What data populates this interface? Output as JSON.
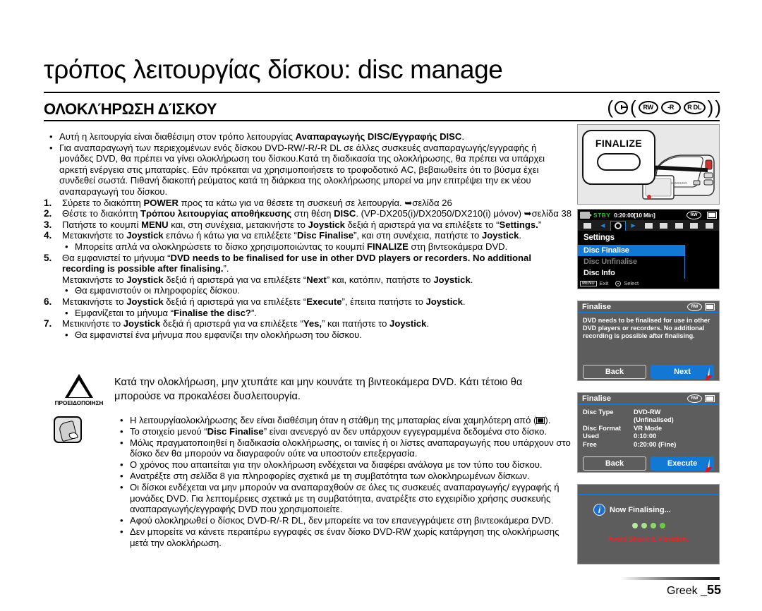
{
  "header": {
    "chapter_title": "τρόπος λειτουργίας δίσκου: disc manage",
    "section_title": "ΟΛΟΚΛΉΡΩΣΗ ΔΊΣΚΟΥ",
    "disc_badges": [
      "RW",
      "-R",
      "R DL"
    ]
  },
  "content": {
    "bullets_top": [
      {
        "parts": [
          {
            "t": "Αυτή η λειτουργία είναι διαθέσιμη στον τρόπο λειτουργίας ",
            "b": false
          },
          {
            "t": "Αναπαραγωγής DISC/Εγγραφής DISC",
            "b": true
          },
          {
            "t": ".",
            "b": false
          }
        ]
      },
      {
        "parts": [
          {
            "t": "Για αναπαραγωγή των περιεχομένων ενός δίσκου DVD-RW/-R/-R DL σε άλλες συσκευές αναπαραγωγής/εγγραφής ή μονάδες DVD, θα πρέπει να γίνει ολοκλήρωση του δίσκου.Κατά τη διαδικασία της ολοκλήρωσης, θα πρέπει να υπάρχει αρκετή ενέργεια στις μπαταρίες. Εάν πρόκειται να χρησιμοποιήσετε το τροφοδοτικό AC, βεβαιωθείτε ότι το βύσμα έχει συνδεθεί σωστά. Πιθανή διακοπή ρεύματος κατά τη διάρκεια της ολοκλήρωσης μπορεί να μην επιτρέψει την εκ νέου αναπαραγωγή του δίσκου.",
            "b": false
          }
        ]
      }
    ],
    "steps": [
      {
        "num": "1.",
        "parts": [
          {
            "t": "Σύρετε το διακόπτη ",
            "b": false
          },
          {
            "t": "POWER",
            "b": true
          },
          {
            "t": " προς τα κάτω για να θέσετε τη συσκευή σε λειτουργία. ➥σελίδα 26",
            "b": false
          }
        ],
        "subs": []
      },
      {
        "num": "2.",
        "parts": [
          {
            "t": "Θέστε το διακόπτη ",
            "b": false
          },
          {
            "t": "Τρόπου λειτουργίας αποθήκευσης",
            "b": true
          },
          {
            "t": " στη θέση ",
            "b": false
          },
          {
            "t": "DISC",
            "b": true
          },
          {
            "t": ". (VP-DX205(i)/DX2050/DX210(i) μόνον) ➥σελίδα 38",
            "b": false
          }
        ],
        "subs": []
      },
      {
        "num": "3.",
        "parts": [
          {
            "t": "Πατήστε το κουμπί ",
            "b": false
          },
          {
            "t": "MENU",
            "b": true
          },
          {
            "t": " και, στη συνέχεια, μετακινήστε το ",
            "b": false
          },
          {
            "t": "Joystick",
            "b": true
          },
          {
            "t": " δεξιά ή αριστερά για να επιλέξετε το “",
            "b": false
          },
          {
            "t": "Settings.",
            "b": true
          },
          {
            "t": "”",
            "b": false
          }
        ],
        "subs": []
      },
      {
        "num": "4.",
        "parts": [
          {
            "t": "Μετακινήστε το ",
            "b": false
          },
          {
            "t": "Joystick",
            "b": true
          },
          {
            "t": " επάνω ή κάτω για να επιλέξετε “",
            "b": false
          },
          {
            "t": "Disc Finalise",
            "b": true
          },
          {
            "t": "”, και στη συνέχεια, πατήστε το ",
            "b": false
          },
          {
            "t": "Joystick",
            "b": true
          },
          {
            "t": ".",
            "b": false
          }
        ],
        "subs": [
          {
            "parts": [
              {
                "t": "Μπορείτε απλά να ολοκληρώσετε το δίσκο χρησιμοποιώντας το κουμπί ",
                "b": false
              },
              {
                "t": "FINALIZE",
                "b": true
              },
              {
                "t": " στη βιντεοκάμερα DVD.",
                "b": false
              }
            ]
          }
        ]
      },
      {
        "num": "5.",
        "parts": [
          {
            "t": "Θα εμφανιστεί το μήνυμα “",
            "b": false
          },
          {
            "t": "DVD needs to be finalised for use in other DVD players or recorders. No additional recording is possible after finalising.",
            "b": true
          },
          {
            "t": "”.",
            "b": false
          },
          {
            "t": "\n",
            "b": false
          },
          {
            "t": "Μετακινήστε το ",
            "b": false
          },
          {
            "t": "Joystick",
            "b": true
          },
          {
            "t": "  δεξιά ή αριστερά για να επιλέξετε “",
            "b": false
          },
          {
            "t": "Next",
            "b": true
          },
          {
            "t": "” και, κατόπιν, πατήστε το ",
            "b": false
          },
          {
            "t": "Joystick",
            "b": true
          },
          {
            "t": ".",
            "b": false
          }
        ],
        "subs": [
          {
            "parts": [
              {
                "t": "Θα εμφανιστούν οι πληροφορίες δίσκου.",
                "b": false
              }
            ]
          }
        ]
      },
      {
        "num": "6.",
        "parts": [
          {
            "t": "Μετακινήστε το ",
            "b": false
          },
          {
            "t": "Joystick",
            "b": true
          },
          {
            "t": " δεξιά ή αριστερά για να επιλέξετε “",
            "b": false
          },
          {
            "t": "Execute",
            "b": true
          },
          {
            "t": "”, έπειτα πατήστε το ",
            "b": false
          },
          {
            "t": "Joystick",
            "b": true
          },
          {
            "t": ".",
            "b": false
          }
        ],
        "subs": [
          {
            "parts": [
              {
                "t": "Εμφανίζεται το μήνυμα “",
                "b": false
              },
              {
                "t": "Finalise the disc?",
                "b": true
              },
              {
                "t": "”.",
                "b": false
              }
            ]
          }
        ]
      },
      {
        "num": "7.",
        "parts": [
          {
            "t": "Μετικινήστε το ",
            "b": false
          },
          {
            "t": "Joystick",
            "b": true
          },
          {
            "t": " δεξιά ή αριστερά για να επιλέξετε “",
            "b": false
          },
          {
            "t": "Yes,",
            "b": true
          },
          {
            "t": "” και πατήστε το ",
            "b": false
          },
          {
            "t": "Joystick",
            "b": true
          },
          {
            "t": ".",
            "b": false
          }
        ],
        "subs": [
          {
            "parts": [
              {
                "t": "Θα εμφανιστεί ένα μήνυμα που εμφανίζει την ολοκλήρωση του δίσκου.",
                "b": false
              }
            ]
          }
        ]
      }
    ]
  },
  "warning": {
    "label": "ΠΡΟΕΙΔΟΠΟΙΗΣΗ",
    "text": "Κατά την ολοκλήρωση, μην χτυπάτε και μην κουνάτε τη βιντεοκάμερα DVD. Κάτι τέτοιο θα μπορούσε να προκαλέσει δυσλειτουργία."
  },
  "notes": [
    {
      "parts": [
        {
          "t": "Η λειτουργίαολοκλήρωσης δεν είναι διαθέσιμη όταν η στάθμη της μπαταρίας είναι χαμηλότερη από (",
          "b": false
        },
        {
          "t": "[battery-icon]",
          "b": false
        },
        {
          "t": ").",
          "b": false
        }
      ]
    },
    {
      "parts": [
        {
          "t": "Το στοιχείο μενού “",
          "b": false
        },
        {
          "t": "Disc Finalise",
          "b": true
        },
        {
          "t": "” είναι ανενεργό αν δεν υπάρχουν εγγεγραμμένα δεδομένα στο δίσκο.",
          "b": false
        }
      ]
    },
    {
      "parts": [
        {
          "t": "Μόλις πραγματοποιηθεί η διαδικασία ολοκλήρωσης, οι ταινίες ή οι λίστες αναπαραγωγής που υπάρχουν στο δίσκο δεν θα μπορούν να διαγραφούν ούτε να υποστούν επεξεργασία.",
          "b": false
        }
      ]
    },
    {
      "parts": [
        {
          "t": "Ο χρόνος που απαιτείται για την ολοκλήρωση ενδέχεται να διαφέρει  ανάλογα με τον τύπο του δίσκου.",
          "b": false
        }
      ]
    },
    {
      "parts": [
        {
          "t": "Ανατρέξτε στη σελίδα 8 για πληροφορίες σχετικά με τη συμβατότητα των ολοκληρωμένων δίσκων.",
          "b": false
        }
      ]
    },
    {
      "parts": [
        {
          "t": "Οι δίσκοι ενδέχεται να μην μπορούν να αναπαραχθούν σε όλες τις συσκευές αναπαραγωγής/ εγγραφής ή μονάδες DVD. Για λεπτομέρειες σχετικά με τη συμβατότητα, ανατρέξτε στο εγχειρίδιο χρήσης  συσκευής αναπαραγωγής/εγγραφής DVD που χρησιμοποιείτε.",
          "b": false
        }
      ]
    },
    {
      "parts": [
        {
          "t": "Αφού ολοκληρωθεί ο δίσκος DVD-R/-R DL, δεν μπορείτε να τον επανεγγράψετε στη βιντεοκάμερα DVD.",
          "b": false
        }
      ]
    },
    {
      "parts": [
        {
          "t": "Δεν μπορείτε να κάνετε  περαιτέρω εγγραφές σε έναν δίσκο DVD-RW χωρίς κατάργηση της ολοκλήρωσης  μετά  την ολοκλήρωση.",
          "b": false
        }
      ]
    }
  ],
  "panels": {
    "camcorder": {
      "button_label": "FINALIZE"
    },
    "menu_screen": {
      "status": {
        "mode": "STBY",
        "timecode": "0:20:00[10 Min]",
        "disc": "RW"
      },
      "title": "Settings",
      "items": [
        {
          "label": "Disc Finalise",
          "state": "selected"
        },
        {
          "label": "Disc Unfinalise",
          "state": "disabled"
        },
        {
          "label": "Disc Info",
          "state": "normal"
        }
      ],
      "footer": {
        "exit_key": "MENU",
        "exit_label": "Exit",
        "select_label": "Select"
      }
    },
    "dialog_next": {
      "title": "Finalise",
      "message": "DVD needs to be finalised for use in other DVD players or recorders. No additional recording is possible after finalising.",
      "buttons": [
        {
          "label": "Back",
          "primary": false
        },
        {
          "label": "Next",
          "primary": true
        }
      ]
    },
    "dialog_info": {
      "title": "Finalise",
      "rows": [
        {
          "key": "Disc Type",
          "value": "DVD-RW\n(Unfinalised)"
        },
        {
          "key": "Disc Format",
          "value": "VR Mode"
        },
        {
          "key": "Used",
          "value": "0:10:00"
        },
        {
          "key": "Free",
          "value": "0:20:00 (Fine)"
        }
      ],
      "buttons": [
        {
          "label": "Back",
          "primary": false
        },
        {
          "label": "Execute",
          "primary": true
        }
      ]
    },
    "progress_screen": {
      "message": "Now Finalising...",
      "warning": "Avoid Shock & Vibration.",
      "dot_count": 4,
      "dot_colors": [
        "#b9e6a0",
        "#a9e08c",
        "#8ed76a",
        "#6bcc3a"
      ]
    }
  },
  "footer": {
    "language": "Greek",
    "page_number": "55"
  },
  "colors": {
    "accent_blue": "#1278d4",
    "status_green": "#27c127",
    "warn_red": "#e02b2b"
  }
}
